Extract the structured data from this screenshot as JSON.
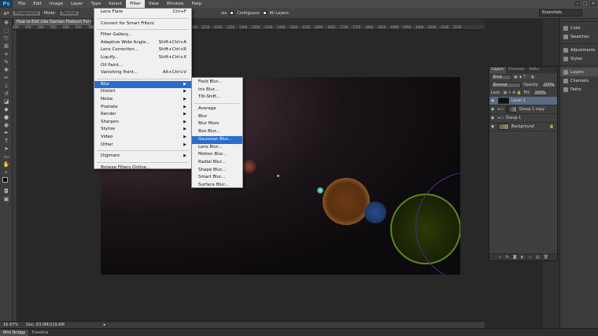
{
  "app": {
    "logo": "Ps",
    "win_buttons": [
      "–",
      "□",
      "×"
    ]
  },
  "menubar": [
    "File",
    "Edit",
    "Image",
    "Layer",
    "Type",
    "Select",
    "Filter",
    "View",
    "Window",
    "Help"
  ],
  "active_menu": "Filter",
  "options": {
    "tool_preset": "Foreground",
    "mode_label": "Mode:",
    "mode_value": "Normal",
    "opacity_frag": "ias",
    "contiguous": "Contiguous",
    "all_layers": "All Layers",
    "workspace": "Essentials"
  },
  "document": {
    "tab_title": "How to Edit Like Damian Piekoort For Car Ed...",
    "ruler_numbers": [
      "400",
      "450",
      "500",
      "550",
      "600",
      "650",
      "700",
      "750",
      "800",
      "850",
      "900",
      "950",
      "1000",
      "1050",
      "1100",
      "1150",
      "1200",
      "1250",
      "1300",
      "1350",
      "1400",
      "1450",
      "1500",
      "1550",
      "1600",
      "1650",
      "1700",
      "1750",
      "1800",
      "1850",
      "1900",
      "1950",
      "2000",
      "2050",
      "2100",
      "2150"
    ]
  },
  "filter_menu": {
    "group1": [
      {
        "label": "Lens Flare",
        "shortcut": "Ctrl+F"
      }
    ],
    "group2": [
      {
        "label": "Convert for Smart Filters",
        "shortcut": ""
      }
    ],
    "group3": [
      {
        "label": "Filter Gallery...",
        "shortcut": ""
      },
      {
        "label": "Adaptive Wide Angle...",
        "shortcut": "Shift+Ctrl+A"
      },
      {
        "label": "Lens Correction...",
        "shortcut": "Shift+Ctrl+R"
      },
      {
        "label": "Liquify...",
        "shortcut": "Shift+Ctrl+X"
      },
      {
        "label": "Oil Paint...",
        "shortcut": ""
      },
      {
        "label": "Vanishing Point...",
        "shortcut": "Alt+Ctrl+V"
      }
    ],
    "group4": [
      "Blur",
      "Distort",
      "Noise",
      "Pixelate",
      "Render",
      "Sharpen",
      "Stylize",
      "Video",
      "Other"
    ],
    "group5": [
      "Digimarc"
    ],
    "group6": [
      "Browse Filters Online..."
    ],
    "selected": "Blur"
  },
  "blur_menu": {
    "group1": [
      "Field Blur...",
      "Iris Blur...",
      "Tilt-Shift..."
    ],
    "group2": [
      "Average",
      "Blur",
      "Blur More",
      "Box Blur...",
      "Gaussian Blur...",
      "Lens Blur...",
      "Motion Blur...",
      "Radial Blur...",
      "Shape Blur...",
      "Smart Blur...",
      "Surface Blur..."
    ],
    "selected": "Gaussian Blur..."
  },
  "dock": {
    "group1": [
      "Color",
      "Swatches"
    ],
    "group2": [
      "Adjustments",
      "Styles"
    ],
    "group3": [
      "Layers",
      "Channels",
      "Paths"
    ]
  },
  "layers_panel": {
    "tabs": [
      "Layers",
      "Channels",
      "Paths"
    ],
    "kind": "Kind",
    "blend_mode": "Normal",
    "opacity_label": "Opacity:",
    "opacity_value": "100%",
    "lock_label": "Lock:",
    "fill_label": "Fill:",
    "fill_value": "100%",
    "layers": [
      "Layer 1",
      "Group 1 copy",
      "Group 1",
      "Background"
    ],
    "bottom_icons": [
      "∞",
      "fx",
      "◙",
      "◐",
      "▭",
      "▤",
      "🗑"
    ]
  },
  "status": {
    "zoom": "16.67%",
    "doc": "Doc: 63.0M/219.6M"
  },
  "bottom_tabs": [
    "Mini Bridge",
    "Timeline"
  ],
  "colors": {
    "menu_bg": "#f0f0f0",
    "highlight": "#2b6ccf",
    "ps_blue": "#5fb0ff"
  }
}
